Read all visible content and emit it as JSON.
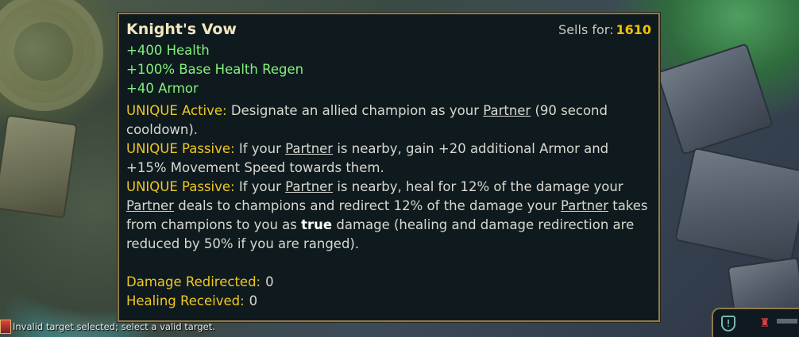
{
  "tooltip": {
    "item_name": "Knight's Vow",
    "sells_label": "Sells for:",
    "sells_price": "1610",
    "stats": [
      "+400 Health",
      "+100% Base Health Regen",
      "+40 Armor"
    ],
    "unique_active_label": "UNIQUE Active:",
    "unique_passive_label": "UNIQUE Passive:",
    "partner": "Partner",
    "active": {
      "l1_a": "Designate an allied champion as your",
      "l1_b": "(90 second",
      "l2": "cooldown)."
    },
    "passive1": {
      "l1_a": "If your",
      "l1_b": "is nearby, gain +20 additional Armor and",
      "l2": "+15% Movement Speed towards them."
    },
    "passive2": {
      "l1_a": "If your",
      "l1_b": "is nearby, heal for 12% of the damage your",
      "l2_b": "deals to champions and redirect 12% of the damage your",
      "l2_c": "takes",
      "l3_a": "from champions to you as",
      "l3_true": "true",
      "l3_b": "damage (healing and damage redirection are",
      "l4": "reduced by 50% if you are ranged)."
    },
    "damage_redirected_label": "Damage Redirected:",
    "damage_redirected_value": "0",
    "healing_received_label": "Healing Received:",
    "healing_received_value": "0"
  },
  "chat": {
    "message": "Invalid target selected; select a valid target."
  },
  "colors": {
    "tooltip_bg": "#0f1a1e",
    "tooltip_border": "#8c7a4c",
    "stat_green": "#84f07c",
    "keyword_gold": "#f0c81e",
    "price_gold": "#f0c000"
  },
  "icons": {
    "minimap_shield": "shield-icon",
    "minimap_tower": "tower-icon",
    "chat_badge": "champion-badge-icon"
  }
}
